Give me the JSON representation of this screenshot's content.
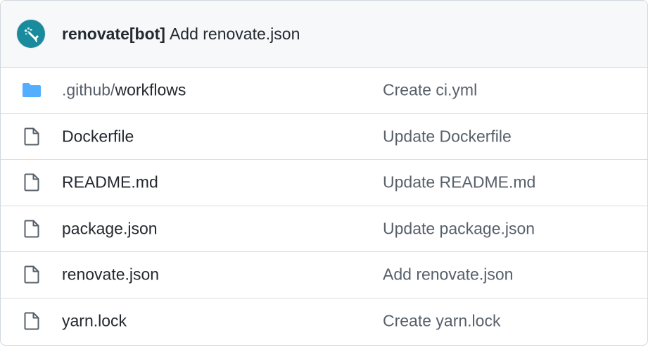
{
  "latest_commit": {
    "author": "renovate[bot]",
    "message": "Add renovate.json",
    "avatar_icon": "renovate-bot-icon",
    "avatar_color": "#1a8a9d"
  },
  "colors": {
    "folder": "#54aeff",
    "file_icon": "#57606a",
    "text_primary": "#24292f",
    "text_muted": "#57606a",
    "header_bg": "#f6f8fa",
    "border": "#d0d7de"
  },
  "files": [
    {
      "type": "folder",
      "icon": "folder-icon",
      "name_prefix": ".github/",
      "name": "workflows",
      "commit": "Create ci.yml"
    },
    {
      "type": "file",
      "icon": "file-icon",
      "name_prefix": "",
      "name": "Dockerfile",
      "commit": "Update Dockerfile"
    },
    {
      "type": "file",
      "icon": "file-icon",
      "name_prefix": "",
      "name": "README.md",
      "commit": "Update README.md"
    },
    {
      "type": "file",
      "icon": "file-icon",
      "name_prefix": "",
      "name": "package.json",
      "commit": "Update package.json"
    },
    {
      "type": "file",
      "icon": "file-icon",
      "name_prefix": "",
      "name": "renovate.json",
      "commit": "Add renovate.json"
    },
    {
      "type": "file",
      "icon": "file-icon",
      "name_prefix": "",
      "name": "yarn.lock",
      "commit": "Create yarn.lock"
    }
  ]
}
